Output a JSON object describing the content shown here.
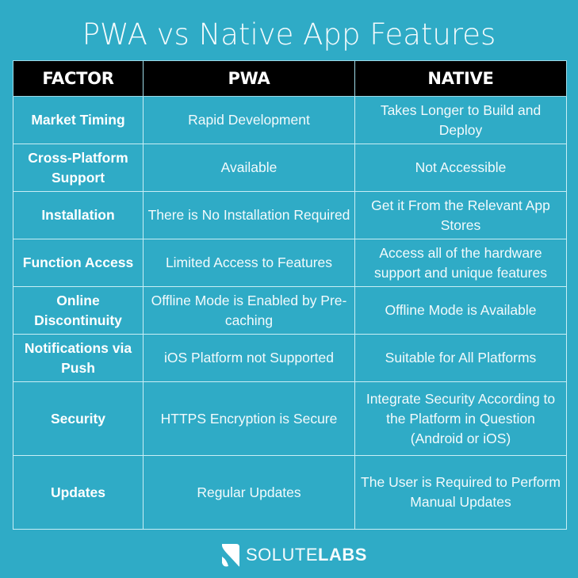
{
  "title": "PWA vs Native App Features",
  "table": {
    "headers": [
      "FACTOR",
      "PWA",
      "NATIVE"
    ],
    "rows": [
      {
        "factor": "Market Timing",
        "pwa": "Rapid Development",
        "native": "Takes Longer to Build and Deploy"
      },
      {
        "factor": "Cross-Platform Support",
        "pwa": "Available",
        "native": "Not Accessible"
      },
      {
        "factor": "Installation",
        "pwa": "There is No Installation Required",
        "native": "Get it From the Relevant App Stores"
      },
      {
        "factor": "Function Access",
        "pwa": "Limited Access to Features",
        "native": "Access all of the hardware support and unique features"
      },
      {
        "factor": "Online Discontinuity",
        "pwa": "Offline Mode is Enabled by Pre-caching",
        "native": "Offline Mode is Available"
      },
      {
        "factor": "Notifications via Push",
        "pwa": "iOS Platform not Supported",
        "native": "Suitable for All Platforms"
      },
      {
        "factor": "Security",
        "pwa": "HTTPS Encryption is Secure",
        "native": "Integrate Security According to the Platform in Question (Android or iOS)"
      },
      {
        "factor": "Updates",
        "pwa": "Regular Updates",
        "native": "The User is Required to Perform Manual Updates"
      }
    ]
  },
  "logo": {
    "icon": "solutelabs-s-icon",
    "text_light": "SOLUTE",
    "text_bold": "LABS"
  },
  "colors": {
    "background": "#2fabc6",
    "header_bg": "#000000",
    "text": "#ffffff"
  }
}
